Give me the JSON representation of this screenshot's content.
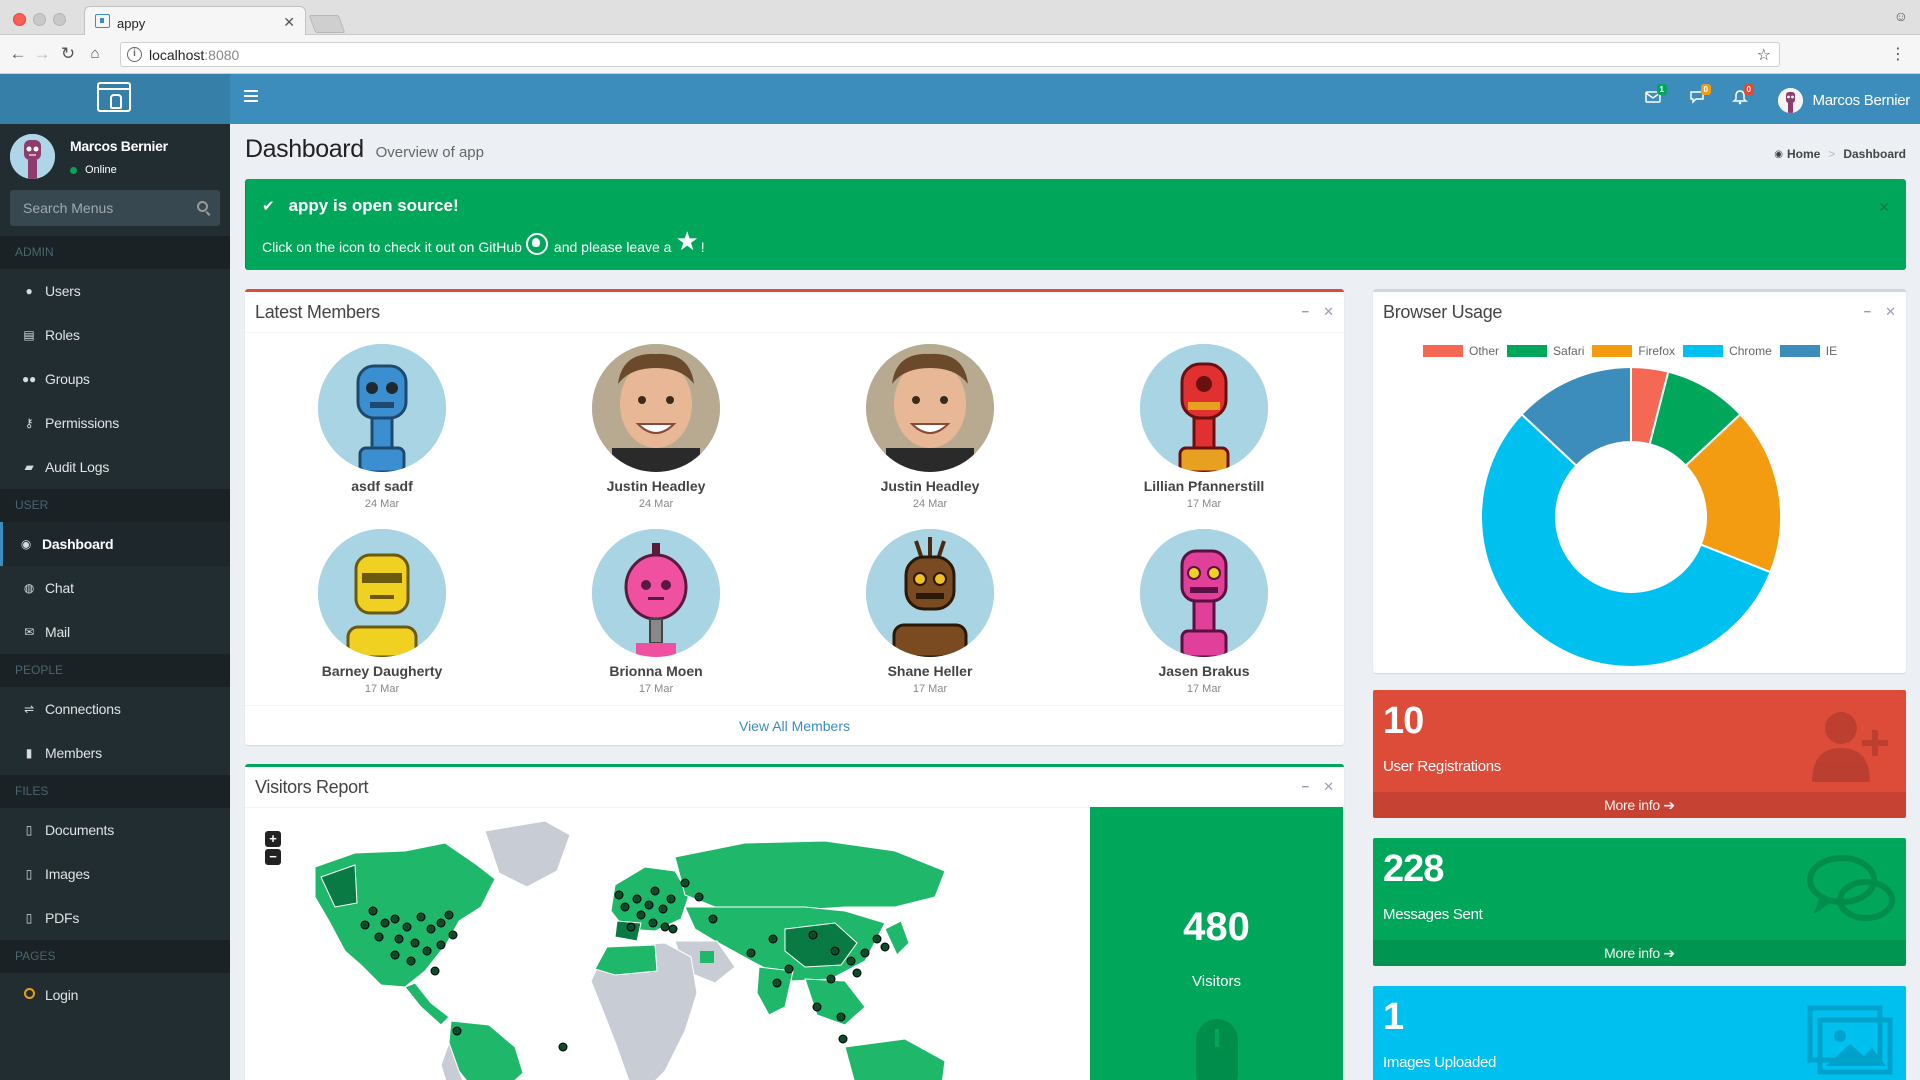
{
  "browser": {
    "tab_title": "appy",
    "url_host": "localhost",
    "url_port": ":8080"
  },
  "header": {
    "badges": {
      "mail": "1",
      "messages": "0",
      "notifications": "0"
    },
    "user_name": "Marcos Bernier"
  },
  "sidebar": {
    "user_name": "Marcos Bernier",
    "status": "Online",
    "search_placeholder": "Search Menus",
    "sections": [
      {
        "header": "ADMIN",
        "items": [
          {
            "label": "Users",
            "icon": "user-icon"
          },
          {
            "label": "Roles",
            "icon": "id-card-icon"
          },
          {
            "label": "Groups",
            "icon": "users-icon"
          },
          {
            "label": "Permissions",
            "icon": "key-icon"
          },
          {
            "label": "Audit Logs",
            "icon": "book-icon"
          }
        ]
      },
      {
        "header": "USER",
        "items": [
          {
            "label": "Dashboard",
            "icon": "dashboard-icon",
            "active": true
          },
          {
            "label": "Chat",
            "icon": "comments-icon"
          },
          {
            "label": "Mail",
            "icon": "envelope-icon"
          }
        ]
      },
      {
        "header": "PEOPLE",
        "items": [
          {
            "label": "Connections",
            "icon": "handshake-icon"
          },
          {
            "label": "Members",
            "icon": "address-book-icon"
          }
        ]
      },
      {
        "header": "FILES",
        "items": [
          {
            "label": "Documents",
            "icon": "file-icon"
          },
          {
            "label": "Images",
            "icon": "image-file-icon"
          },
          {
            "label": "PDFs",
            "icon": "pdf-icon"
          }
        ]
      },
      {
        "header": "PAGES",
        "items": [
          {
            "label": "Login",
            "icon": "circle-icon"
          }
        ]
      }
    ]
  },
  "content": {
    "title": "Dashboard",
    "subtitle": "Overview of app",
    "breadcrumb": {
      "home": "Home",
      "current": "Dashboard"
    }
  },
  "callout": {
    "title": "appy is open source!",
    "message_before": "Click on the icon to check it out on GitHub",
    "message_middle": "and please leave a",
    "message_after": "!"
  },
  "latest_members": {
    "title": "Latest Members",
    "footer_link": "View All Members",
    "members": [
      {
        "name": "asdf sadf",
        "date": "24 Mar",
        "avatar": "blue-robot"
      },
      {
        "name": "Justin Headley",
        "date": "24 Mar",
        "avatar": "photo"
      },
      {
        "name": "Justin Headley",
        "date": "24 Mar",
        "avatar": "photo"
      },
      {
        "name": "Lillian Pfannerstill",
        "date": "17 Mar",
        "avatar": "red-robot"
      },
      {
        "name": "Barney Daugherty",
        "date": "17 Mar",
        "avatar": "yellow-robot"
      },
      {
        "name": "Brionna Moen",
        "date": "17 Mar",
        "avatar": "pink-robot"
      },
      {
        "name": "Shane Heller",
        "date": "17 Mar",
        "avatar": "brown-robot"
      },
      {
        "name": "Jasen Brakus",
        "date": "17 Mar",
        "avatar": "magenta-robot"
      }
    ]
  },
  "browser_usage": {
    "title": "Browser Usage",
    "colors": {
      "Other": "#f56954",
      "Safari": "#00a65a",
      "Firefox": "#f39c12",
      "Chrome": "#00c0ef",
      "IE": "#3c8dbc"
    }
  },
  "chart_data": {
    "type": "pie",
    "categories": [
      "Other",
      "Safari",
      "Firefox",
      "Chrome",
      "IE"
    ],
    "values": [
      4,
      9,
      18,
      56,
      13
    ]
  },
  "stats": [
    {
      "number": "10",
      "label": "User Registrations",
      "link": "More info",
      "color": "#dd4b39",
      "icon": "user-plus-icon"
    },
    {
      "number": "228",
      "label": "Messages Sent",
      "link": "More info",
      "color": "#00a65a",
      "icon": "comments-icon"
    },
    {
      "number": "1",
      "label": "Images Uploaded",
      "link": "",
      "color": "#00c0ef",
      "icon": "images-icon"
    }
  ],
  "visitors": {
    "title": "Visitors Report",
    "count": "480",
    "label": "Visitors",
    "zoom_in": "+",
    "zoom_out": "−"
  }
}
